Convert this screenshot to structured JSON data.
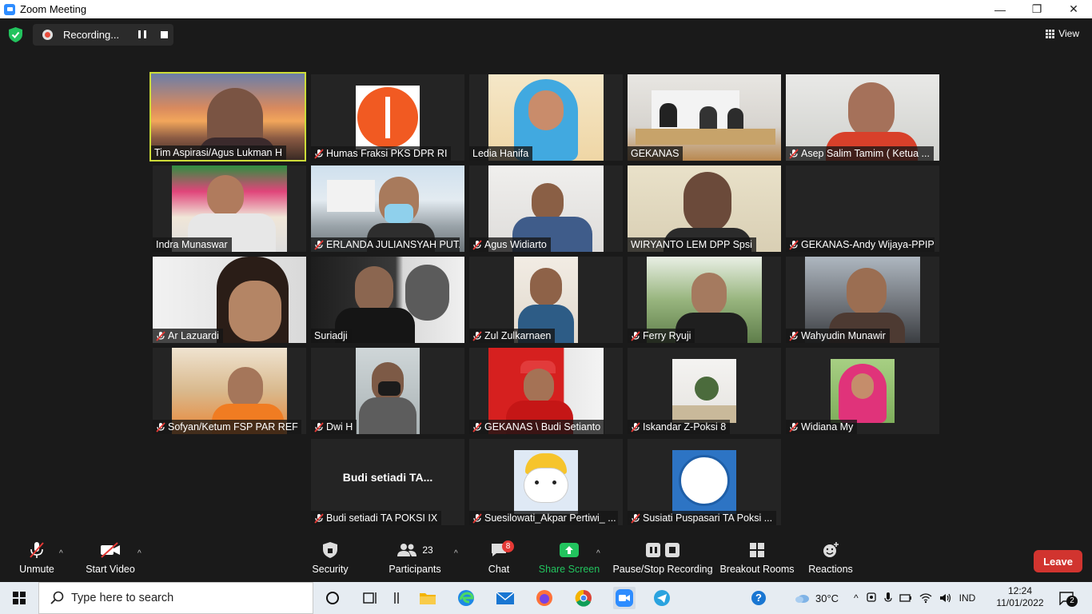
{
  "window": {
    "title": "Zoom Meeting",
    "min_glyph": "—",
    "max_glyph": "❐",
    "close_glyph": "✕"
  },
  "recording": {
    "label": "Recording..."
  },
  "view": {
    "label": "View"
  },
  "participants": [
    {
      "name": "Tim Aspirasi/Agus Lukman H",
      "muted": false,
      "active": true
    },
    {
      "name": "Humas Fraksi PKS DPR RI",
      "muted": true
    },
    {
      "name": "Ledia Hanifa",
      "muted": false
    },
    {
      "name": "GEKANAS",
      "muted": false
    },
    {
      "name": "Asep Salim Tamim ( Ketua ...",
      "muted": true
    },
    {
      "name": "Indra Munaswar",
      "muted": false
    },
    {
      "name": "ERLANDA JULIANSYAH PUT...",
      "muted": true
    },
    {
      "name": "Agus Widiarto",
      "muted": true
    },
    {
      "name": "WIRYANTO LEM DPP Spsi",
      "muted": false
    },
    {
      "name": "GEKANAS-Andy Wijaya-PPIP",
      "muted": true
    },
    {
      "name": "Ar Lazuardi",
      "muted": true
    },
    {
      "name": "Suriadji",
      "muted": false
    },
    {
      "name": "Zul Zulkarnaen",
      "muted": true
    },
    {
      "name": "Ferry Ryuji",
      "muted": true
    },
    {
      "name": "Wahyudin Munawir",
      "muted": true
    },
    {
      "name": "Sofyan/Ketum FSP PAR REF",
      "muted": true
    },
    {
      "name": "Dwi H",
      "muted": true
    },
    {
      "name": "GEKANAS \\ Budi Setianto",
      "muted": true
    },
    {
      "name": "Iskandar Z-Poksi 8",
      "muted": true
    },
    {
      "name": "Widiana My",
      "muted": true
    },
    {
      "name": "Budi setiadi TA POKSI IX",
      "muted": true,
      "avatar_text": "Budi setiadi TA..."
    },
    {
      "name": "Suesilowati_Akpar Pertiwi_ ...",
      "muted": true
    },
    {
      "name": "Susiati Puspasari TA Poksi ...",
      "muted": true
    }
  ],
  "toolbar": {
    "unmute": "Unmute",
    "start_video": "Start Video",
    "security": "Security",
    "participants": "Participants",
    "participants_count": "23",
    "chat": "Chat",
    "chat_badge": "8",
    "share_screen": "Share Screen",
    "record": "Pause/Stop Recording",
    "breakout": "Breakout Rooms",
    "reactions": "Reactions",
    "leave": "Leave",
    "caret": "^"
  },
  "taskbar": {
    "search_placeholder": "Type here to search",
    "temperature": "30°C",
    "language": "IND",
    "time": "12:24",
    "date": "11/01/2022",
    "notifications": "2"
  },
  "colors": {
    "accent_green": "#1db954",
    "leave_red": "#d1342f",
    "active_border": "#cddc39",
    "zoom_blue": "#2d8cff"
  }
}
